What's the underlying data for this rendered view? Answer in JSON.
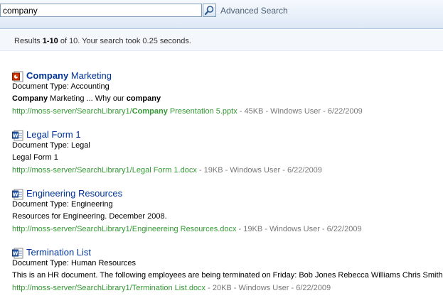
{
  "search": {
    "query": "company",
    "advanced_label": "Advanced Search"
  },
  "status": {
    "prefix": "Results ",
    "range": "1-10",
    "middle": " of 10. Your search took 0.25 seconds."
  },
  "results": [
    {
      "icon": "powerpoint-icon",
      "title_bold": "Company",
      "title_rest": " Marketing",
      "doc_type": "Document Type: Accounting",
      "snippet_parts": [
        {
          "text": "Company",
          "bold": true
        },
        {
          "text": " Marketing ... Why our ",
          "bold": false
        },
        {
          "text": "company",
          "bold": true
        }
      ],
      "url_prefix": "http://moss-server/SearchLibrary1/",
      "url_bold": "Company",
      "url_rest": " Presentation 5.pptx",
      "meta": " - 45KB - Windows User - 6/22/2009"
    },
    {
      "icon": "word-icon",
      "title_bold": "",
      "title_rest": "Legal Form 1",
      "doc_type": "Document Type: Legal",
      "snippet_parts": [
        {
          "text": "Legal Form 1",
          "bold": false
        }
      ],
      "url_prefix": "http://moss-server/SearchLibrary1/",
      "url_bold": "",
      "url_rest": "Legal Form 1.docx",
      "meta": " - 19KB - Windows User - 6/22/2009"
    },
    {
      "icon": "word-icon",
      "title_bold": "",
      "title_rest": "Engineering Resources",
      "doc_type": "Document Type: Engineering",
      "snippet_parts": [
        {
          "text": "Resources for Engineering. December 2008.",
          "bold": false
        }
      ],
      "url_prefix": "http://moss-server/SearchLibrary1/",
      "url_bold": "",
      "url_rest": "Engineereing Resources.docx",
      "meta": " - 19KB - Windows User - 6/22/2009"
    },
    {
      "icon": "word-icon",
      "title_bold": "",
      "title_rest": "Termination List",
      "doc_type": "Document Type: Human Resources",
      "snippet_parts": [
        {
          "text": "This is an HR document. The following employees are being terminated on Friday: Bob Jones Rebecca Williams Chris Smith",
          "bold": false
        }
      ],
      "url_prefix": "http://moss-server/SearchLibrary1/",
      "url_bold": "",
      "url_rest": "Termination List.docx",
      "meta": " - 20KB - Windows User - 6/22/2009"
    }
  ]
}
